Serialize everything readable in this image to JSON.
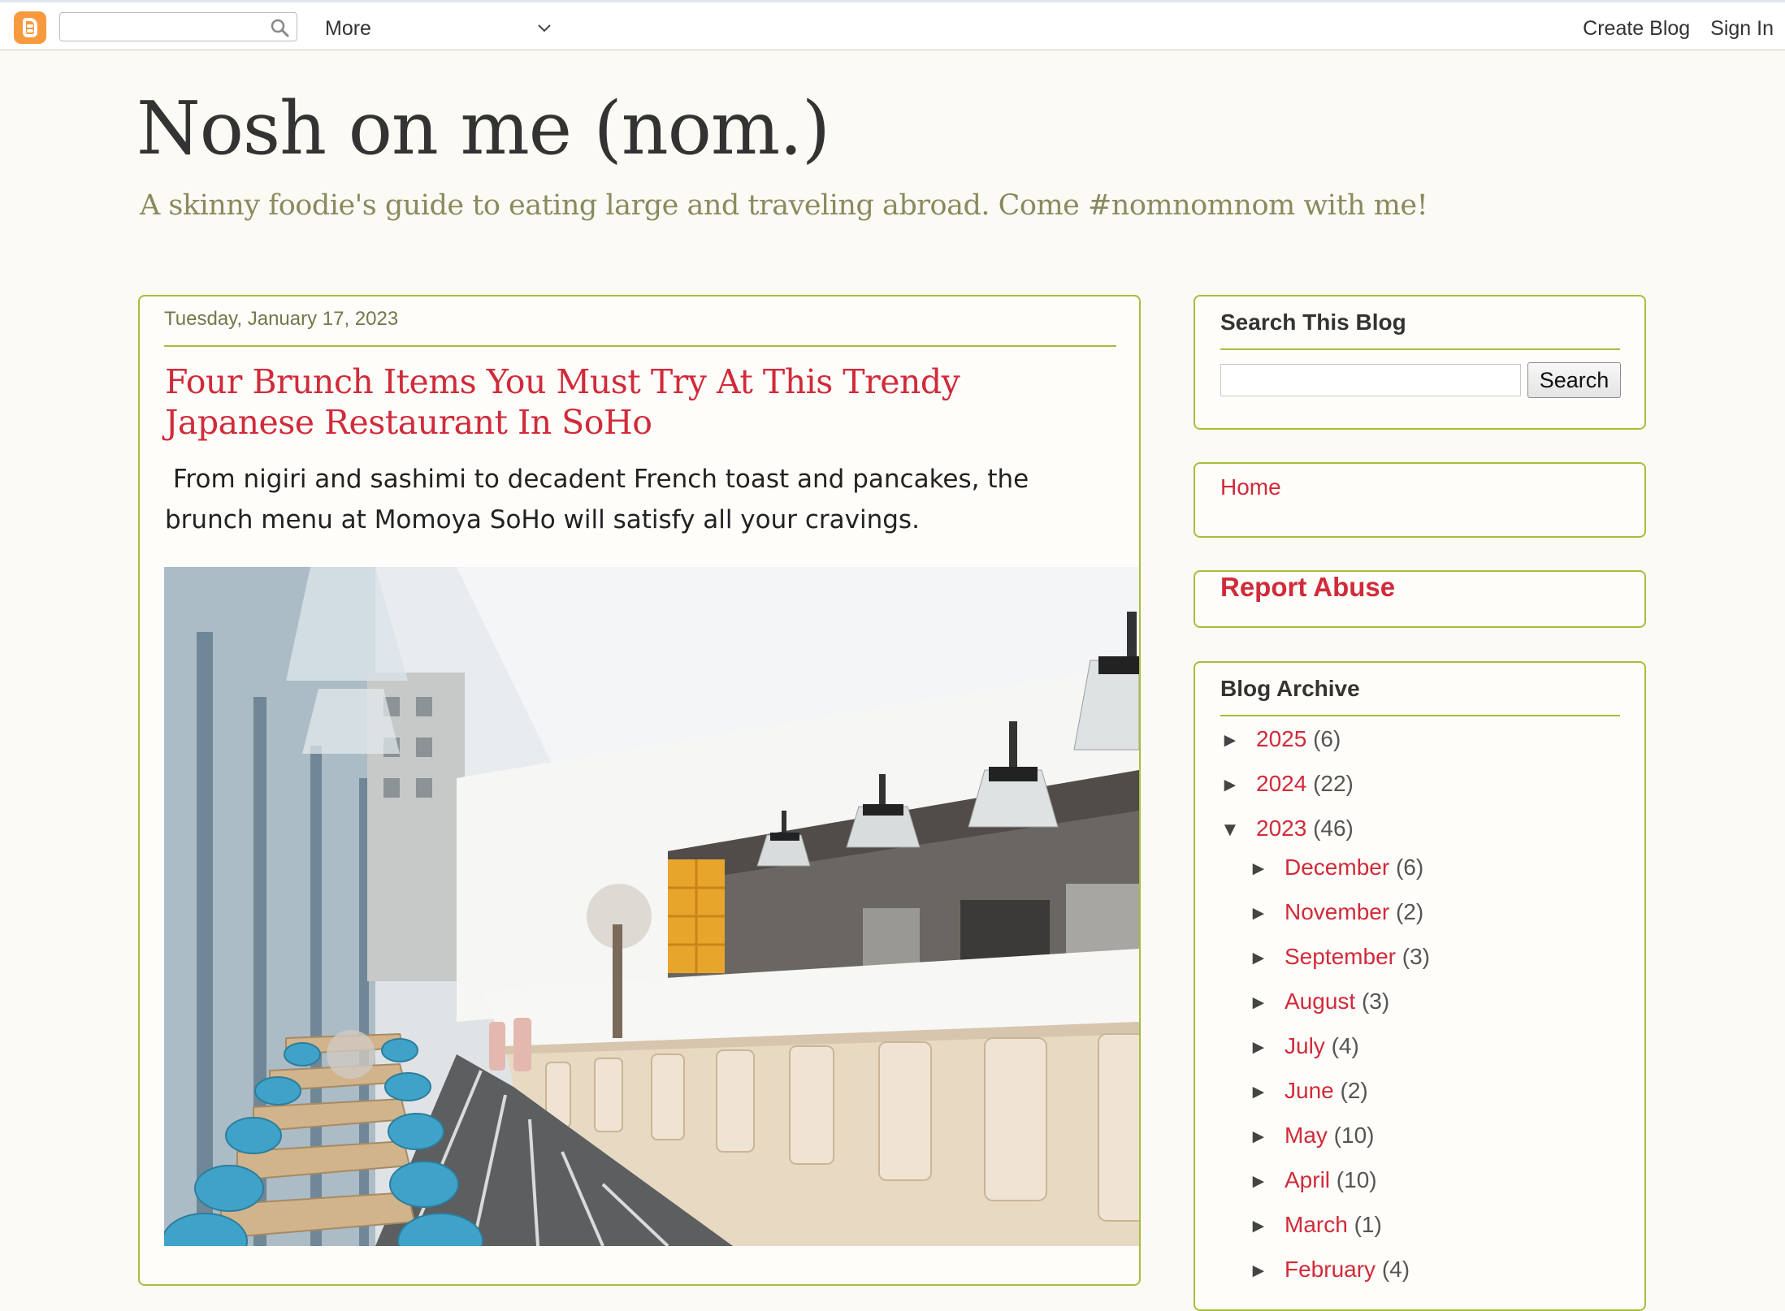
{
  "navbar": {
    "search_placeholder": "",
    "more_label": "More",
    "create_blog": "Create Blog",
    "sign_in": "Sign In"
  },
  "header": {
    "title": "Nosh on me (nom.)",
    "description": "A skinny foodie's guide to eating large and traveling abroad. Come #nomnomnom with me!"
  },
  "post": {
    "date": "Tuesday, January 17, 2023",
    "title": "Four Brunch Items You Must Try At This Trendy Japanese Restaurant In SoHo",
    "summary": " From nigiri and sashimi to decadent French toast and pancakes, the brunch menu at Momoya SoHo will satisfy all your cravings."
  },
  "sidebar": {
    "search": {
      "title": "Search This Blog",
      "input_value": "",
      "button_label": "Search"
    },
    "pages": {
      "home": "Home"
    },
    "report_abuse": "Report Abuse",
    "archive": {
      "title": "Blog Archive",
      "years": [
        {
          "toggle": "►",
          "label": "2025",
          "count": "(6)"
        },
        {
          "toggle": "►",
          "label": "2024",
          "count": "(22)"
        },
        {
          "toggle": "▼",
          "label": "2023",
          "count": "(46)"
        }
      ],
      "months": [
        {
          "toggle": "►",
          "label": "December",
          "count": "(6)"
        },
        {
          "toggle": "►",
          "label": "November",
          "count": "(2)"
        },
        {
          "toggle": "►",
          "label": "September",
          "count": "(3)"
        },
        {
          "toggle": "►",
          "label": "August",
          "count": "(3)"
        },
        {
          "toggle": "►",
          "label": "July",
          "count": "(4)"
        },
        {
          "toggle": "►",
          "label": "June",
          "count": "(2)"
        },
        {
          "toggle": "►",
          "label": "May",
          "count": "(10)"
        },
        {
          "toggle": "►",
          "label": "April",
          "count": "(10)"
        },
        {
          "toggle": "►",
          "label": "March",
          "count": "(1)"
        },
        {
          "toggle": "►",
          "label": "February",
          "count": "(4)"
        }
      ]
    }
  },
  "colors": {
    "accent_border": "#a6be3c",
    "link_red": "#d02b3a",
    "page_bg": "#fbfaf5",
    "blogger_orange": "#f79a3e"
  }
}
